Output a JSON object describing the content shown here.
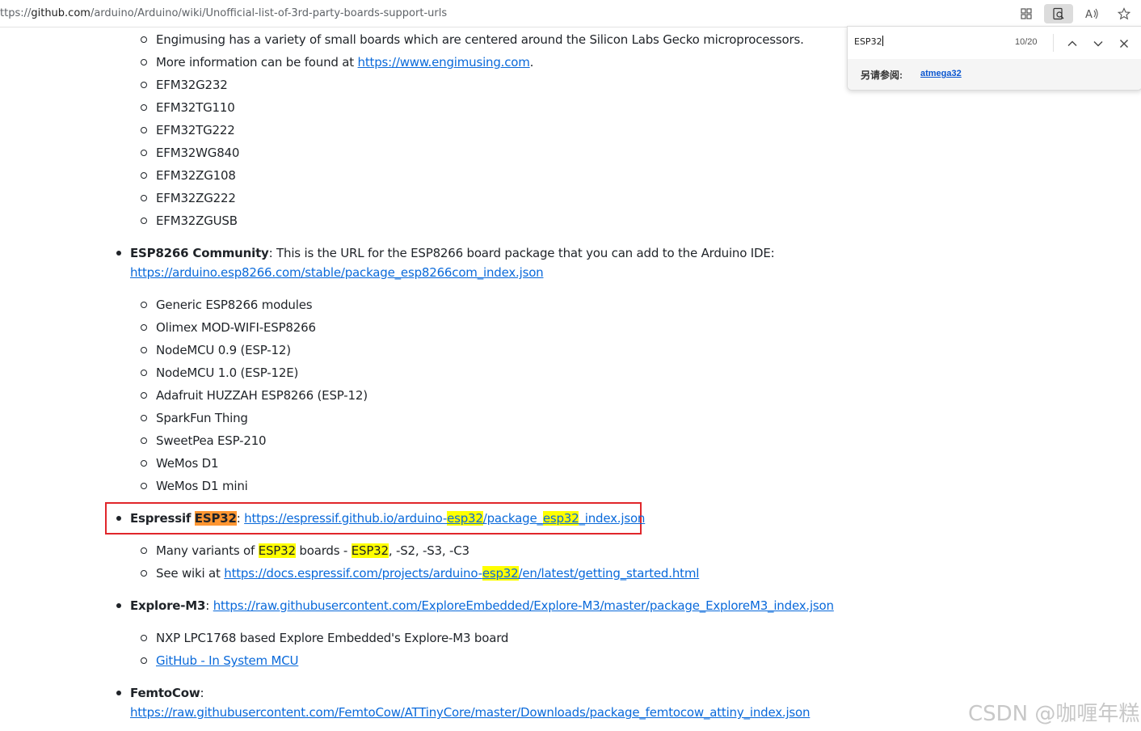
{
  "browser": {
    "url_prefix": "ttps://",
    "url_host": "github.com",
    "url_path": "/arduino/Arduino/wiki/Unofficial-list-of-3rd-party-boards-support-urls"
  },
  "find": {
    "query": "ESP32",
    "count": "10/20",
    "see_also_label": "另请参阅:",
    "see_also_link": "atmega32"
  },
  "content": {
    "engimusing_desc": "Engimusing has a variety of small boards which are centered around the Silicon Labs Gecko microprocessors.",
    "engimusing_more": "More information can be found at",
    "engimusing_url": "https://www.engimusing.com",
    "engimusing_period": ".",
    "efm_boards": [
      "EFM32G232",
      "EFM32TG110",
      "EFM32TG222",
      "EFM32WG840",
      "EFM32ZG108",
      "EFM32ZG222",
      "EFM32ZGUSB"
    ],
    "esp8266_title": "ESP8266 Community",
    "esp8266_desc": ": This is the URL for the ESP8266 board package that you can add to the Arduino IDE:",
    "esp8266_url": "https://arduino.esp8266.com/stable/package_esp8266com_index.json",
    "esp8266_boards": [
      "Generic ESP8266 modules",
      "Olimex MOD-WIFI-ESP8266",
      "NodeMCU 0.9 (ESP-12)",
      "NodeMCU 1.0 (ESP-12E)",
      "Adafruit HUZZAH ESP8266 (ESP-12)",
      "SparkFun Thing",
      "SweetPea ESP-210",
      "WeMos D1",
      "WeMos D1 mini"
    ],
    "espressif_title": "Espressif",
    "espressif_hl": "ESP32",
    "colon": ":",
    "espressif_url_1": "https://espressif.github.io/arduino-",
    "espressif_url_hl1": "esp32",
    "espressif_url_2": "/package_",
    "espressif_url_hl2": "esp32",
    "espressif_url_3": "_index.json",
    "variants_1": "Many variants of",
    "variants_hl1": "ESP32",
    "variants_2": "boards -",
    "variants_hl2": "ESP32",
    "variants_3": ", -S2, -S3, -C3",
    "wiki_1": "See wiki at",
    "wiki_url_1": "https://docs.espressif.com/projects/arduino-",
    "wiki_url_hl": "esp32",
    "wiki_url_2": "/en/latest/getting_started.html",
    "explore_title": "Explore-M3",
    "explore_url": "https://raw.githubusercontent.com/ExploreEmbedded/Explore-M3/master/package_ExploreM3_index.json",
    "explore_board": "NXP LPC1768 based Explore Embedded's Explore-M3 board",
    "explore_link": "GitHub - In System MCU",
    "femtocow_title": "FemtoCow",
    "femtocow_url": "https://raw.githubusercontent.com/FemtoCow/ATTinyCore/master/Downloads/package_femtocow_attiny_index.json"
  },
  "watermark": "CSDN @咖喱年糕"
}
